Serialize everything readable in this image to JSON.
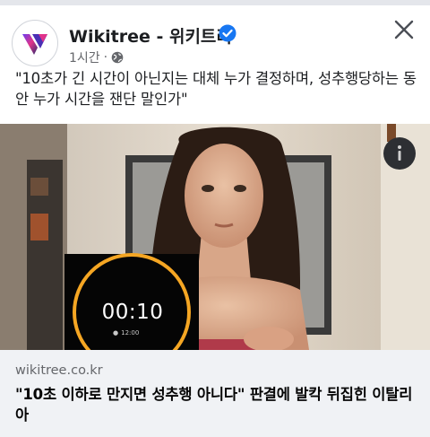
{
  "header": {
    "page_name": "Wikitree - 위키트리",
    "time": "1시간",
    "separator": "·",
    "icons": [
      "wikitree-logo",
      "verified-badge-icon",
      "globe-icon",
      "close-icon"
    ]
  },
  "post": {
    "text": "\"10초가 긴 시간이 아닌지는 대체 누가 결정하며, 성추행당하는 동안 누가 시간을 잰단 말인가\""
  },
  "media": {
    "timer_display": "00:10",
    "alarm_time": "12:00",
    "info_icon": "info-icon"
  },
  "link_card": {
    "domain": "wikitree.co.kr",
    "headline": "\"10초 이하로 만지면 성추행 아니다\" 판결에 발칵 뒤집힌 이탈리아"
  },
  "colors": {
    "verified": "#1877f2",
    "card_bg": "#f0f2f5",
    "timer_ring": "#f5a623"
  }
}
